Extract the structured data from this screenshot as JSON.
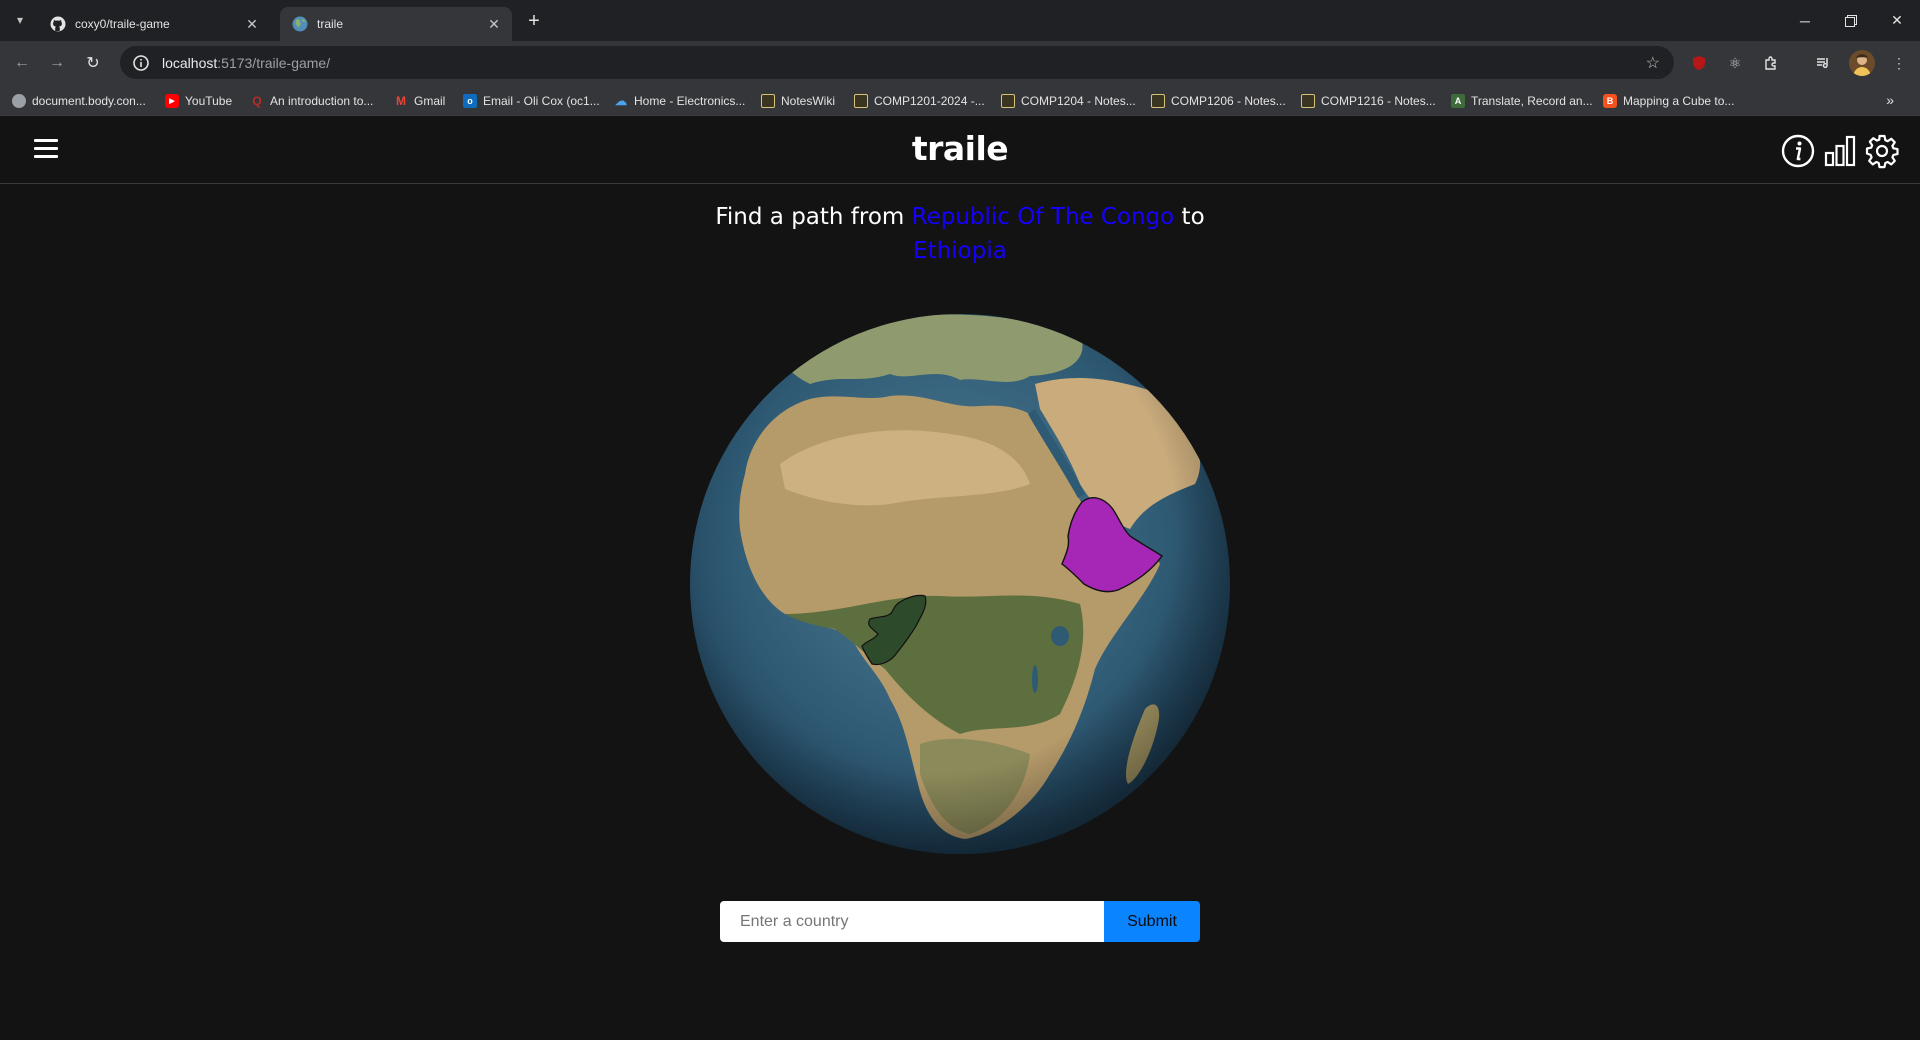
{
  "browser": {
    "tabs": [
      {
        "title": "coxy0/traile-game",
        "active": false,
        "favicon": "github-icon"
      },
      {
        "title": "traile",
        "active": true,
        "favicon": "globe-icon"
      }
    ],
    "url_host": "localhost",
    "url_path": ":5173/traile-game/",
    "bookmarks": [
      {
        "label": "document.body.con...",
        "icon": "globe-icon"
      },
      {
        "label": "YouTube",
        "icon": "youtube-icon"
      },
      {
        "label": "An introduction to...",
        "icon": "quora-icon"
      },
      {
        "label": "Gmail",
        "icon": "gmail-icon"
      },
      {
        "label": "Email - Oli Cox (oc1...",
        "icon": "outlook-icon"
      },
      {
        "label": "Home - Electronics...",
        "icon": "cloud-icon"
      },
      {
        "label": "NotesWiki",
        "icon": "chip-icon"
      },
      {
        "label": "COMP1201-2024 -...",
        "icon": "chip-icon"
      },
      {
        "label": "COMP1204 - Notes...",
        "icon": "chip-icon"
      },
      {
        "label": "COMP1206 - Notes...",
        "icon": "chip-icon"
      },
      {
        "label": "COMP1216 - Notes...",
        "icon": "chip-icon"
      },
      {
        "label": "Translate, Record an...",
        "icon": "translate-icon"
      },
      {
        "label": "Mapping a Cube to...",
        "icon": "blogger-icon"
      }
    ]
  },
  "app": {
    "title": "traile",
    "prompt": {
      "prefix": "Find a path from",
      "start_country": "Republic Of The Congo",
      "connector": "to",
      "end_country": "Ethiopia"
    },
    "globe": {
      "start_highlight_color": "#2d4a2a",
      "end_highlight_color": "#a626b5"
    },
    "input_placeholder": "Enter a country",
    "submit_label": "Submit"
  },
  "colors": {
    "background": "#131313",
    "country_link": "#1500ff",
    "submit_button": "#0a84ff"
  }
}
